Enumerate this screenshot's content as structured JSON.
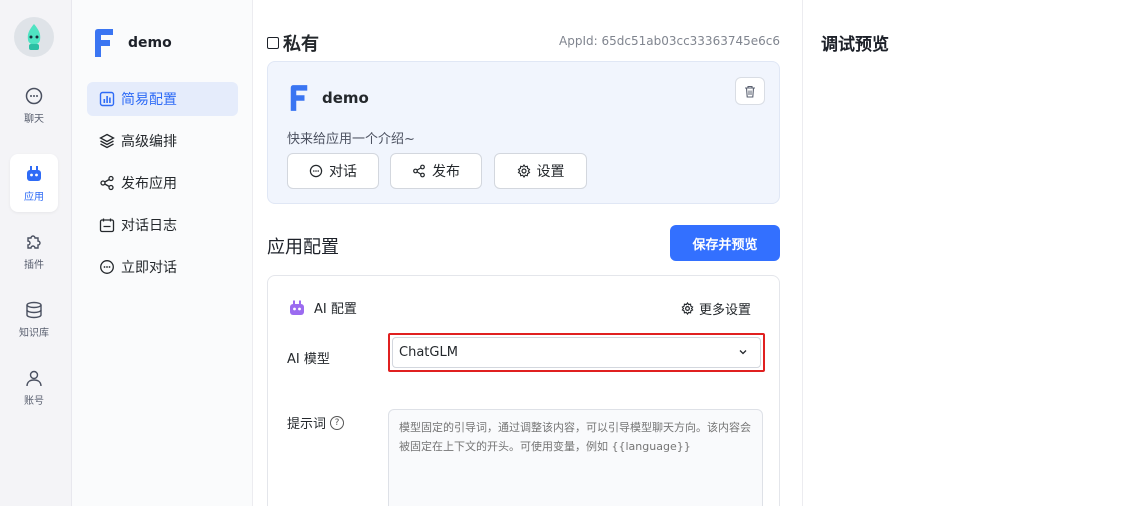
{
  "rail": {
    "items": [
      {
        "label": "聊天",
        "icon": "chat-bubble-icon"
      },
      {
        "label": "应用",
        "icon": "robot-icon",
        "active": true
      },
      {
        "label": "插件",
        "icon": "puzzle-icon"
      },
      {
        "label": "知识库",
        "icon": "database-icon"
      },
      {
        "label": "账号",
        "icon": "user-icon"
      }
    ]
  },
  "sidebar": {
    "app_name": "demo",
    "items": [
      {
        "label": "简易配置",
        "icon": "chart-icon",
        "active": true
      },
      {
        "label": "高级编排",
        "icon": "layers-icon"
      },
      {
        "label": "发布应用",
        "icon": "share-icon"
      },
      {
        "label": "对话日志",
        "icon": "calendar-icon"
      },
      {
        "label": "立即对话",
        "icon": "chat-bubble-icon"
      }
    ]
  },
  "main": {
    "title": "私有",
    "appid": "AppId: 65dc51ab03cc33363745e6c6",
    "card": {
      "name": "demo",
      "intro": "快来给应用一个介绍~",
      "buttons": {
        "chat": "对话",
        "publish": "发布",
        "settings": "设置"
      }
    },
    "section_title": "应用配置",
    "save_label": "保存并预览",
    "config": {
      "title": "AI 配置",
      "more": "更多设置",
      "model_label": "AI 模型",
      "model_value": "ChatGLM",
      "prompt_label": "提示词",
      "prompt_placeholder": "模型固定的引导词，通过调整该内容，可以引导模型聊天方向。该内容会被固定在上下文的开头。可使用变量，例如 {{language}}"
    }
  },
  "preview": {
    "title": "调试预览"
  },
  "colors": {
    "accent": "#3370ff",
    "highlight": "#e02020",
    "active_bg": "#e5ecfb"
  }
}
